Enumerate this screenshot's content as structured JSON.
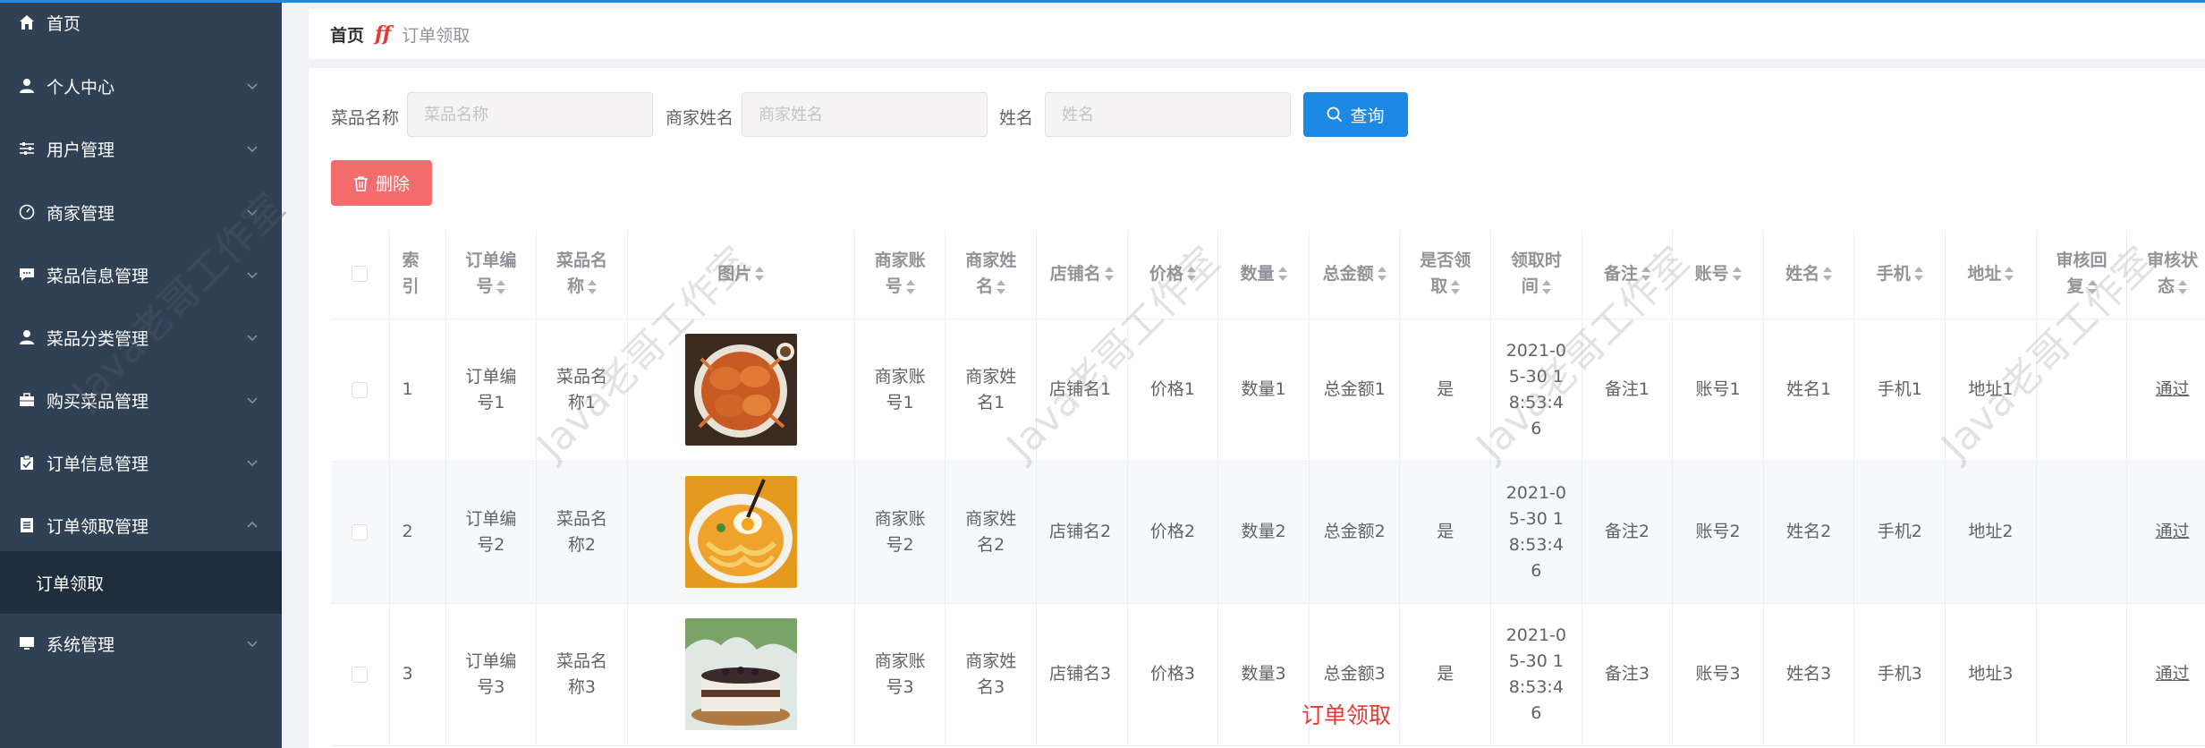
{
  "sidebar": {
    "items": [
      {
        "label": "首页",
        "icon": "home-icon",
        "has_children": false
      },
      {
        "label": "个人中心",
        "icon": "user-icon",
        "has_children": true
      },
      {
        "label": "用户管理",
        "icon": "sliders-icon",
        "has_children": true
      },
      {
        "label": "商家管理",
        "icon": "dashboard-icon",
        "has_children": true
      },
      {
        "label": "菜品信息管理",
        "icon": "chat-icon",
        "has_children": true
      },
      {
        "label": "菜品分类管理",
        "icon": "user-icon",
        "has_children": true
      },
      {
        "label": "购买菜品管理",
        "icon": "briefcase-icon",
        "has_children": true
      },
      {
        "label": "订单信息管理",
        "icon": "clipboard-icon",
        "has_children": true
      },
      {
        "label": "订单领取管理",
        "icon": "document-icon",
        "has_children": true,
        "expanded": true
      },
      {
        "label": "系统管理",
        "icon": "monitor-icon",
        "has_children": true
      }
    ],
    "sub_item": "订单领取"
  },
  "breadcrumb": {
    "home": "首页",
    "separator": "ff",
    "current": "订单领取"
  },
  "search": {
    "dish_label": "菜品名称",
    "dish_placeholder": "菜品名称",
    "merchant_label": "商家姓名",
    "merchant_placeholder": "商家姓名",
    "name_label": "姓名",
    "name_placeholder": "姓名",
    "query_button": "查询"
  },
  "actions": {
    "delete_button": "删除"
  },
  "table": {
    "headers": [
      "索引",
      "订单编号",
      "菜品名称",
      "图片",
      "商家账号",
      "商家姓名",
      "店铺名",
      "价格",
      "数量",
      "总金额",
      "是否领取",
      "领取时间",
      "备注",
      "账号",
      "姓名",
      "手机",
      "地址",
      "审核回复",
      "审核状态"
    ],
    "rows": [
      {
        "index": "1",
        "order_no": "订单编号1",
        "dish": "菜品名称1",
        "image": "crab-dish",
        "merchant_account": "商家账号1",
        "merchant_name": "商家姓名1",
        "shop": "店铺名1",
        "price": "价格1",
        "quantity": "数量1",
        "total": "总金额1",
        "claimed": "是",
        "time": "2021-05-30 18:53:46",
        "note": "备注1",
        "account": "账号1",
        "name": "姓名1",
        "phone": "手机1",
        "address": "地址1",
        "reply": "",
        "status": "通过"
      },
      {
        "index": "2",
        "order_no": "订单编号2",
        "dish": "菜品名称2",
        "image": "noodle-dish",
        "merchant_account": "商家账号2",
        "merchant_name": "商家姓名2",
        "shop": "店铺名2",
        "price": "价格2",
        "quantity": "数量2",
        "total": "总金额2",
        "claimed": "是",
        "time": "2021-05-30 18:53:46",
        "note": "备注2",
        "account": "账号2",
        "name": "姓名2",
        "phone": "手机2",
        "address": "地址2",
        "reply": "",
        "status": "通过"
      },
      {
        "index": "3",
        "order_no": "订单编号3",
        "dish": "菜品名称3",
        "image": "cake-dish",
        "merchant_account": "商家账号3",
        "merchant_name": "商家姓名3",
        "shop": "店铺名3",
        "price": "价格3",
        "quantity": "数量3",
        "total": "总金额3",
        "claimed": "是",
        "time": "2021-05-30 18:53:46",
        "note": "备注3",
        "account": "账号3",
        "name": "姓名3",
        "phone": "手机3",
        "address": "地址3",
        "reply": "",
        "status": "通过"
      }
    ]
  },
  "watermark": "Java老哥工作室",
  "overlay_label": "订单领取",
  "colors": {
    "sidebar_bg": "#304156",
    "primary": "#1e88e5",
    "danger": "#f56c6c",
    "accent_red": "#e53935"
  }
}
